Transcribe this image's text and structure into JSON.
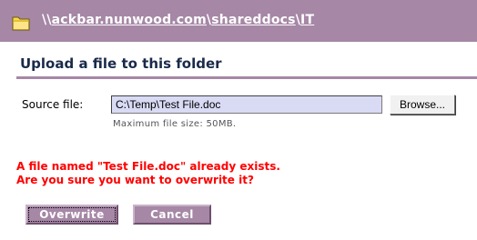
{
  "header": {
    "path_prefix": "\\\\",
    "path_host": "ackbar.nunwood.com",
    "path_sep1": "\\",
    "path_share": "shareddocs",
    "path_sep2": "\\",
    "path_folder": "IT",
    "icon": "folder-icon"
  },
  "upload": {
    "title": "Upload a file to this folder",
    "source_label": "Source file:",
    "source_value": "C:\\Temp\\Test File.doc",
    "browse_label": "Browse...",
    "max_size_text": "Maximum file size: 50MB."
  },
  "warning": {
    "line1": "A file named \"Test File.doc\" already exists.",
    "line2": "Are you sure you want to overwrite it?"
  },
  "actions": {
    "overwrite_label": "Overwrite",
    "cancel_label": "Cancel"
  },
  "colors": {
    "accent": "#a687a6",
    "warning": "#ff0000",
    "input_bg": "#d9daf4"
  }
}
